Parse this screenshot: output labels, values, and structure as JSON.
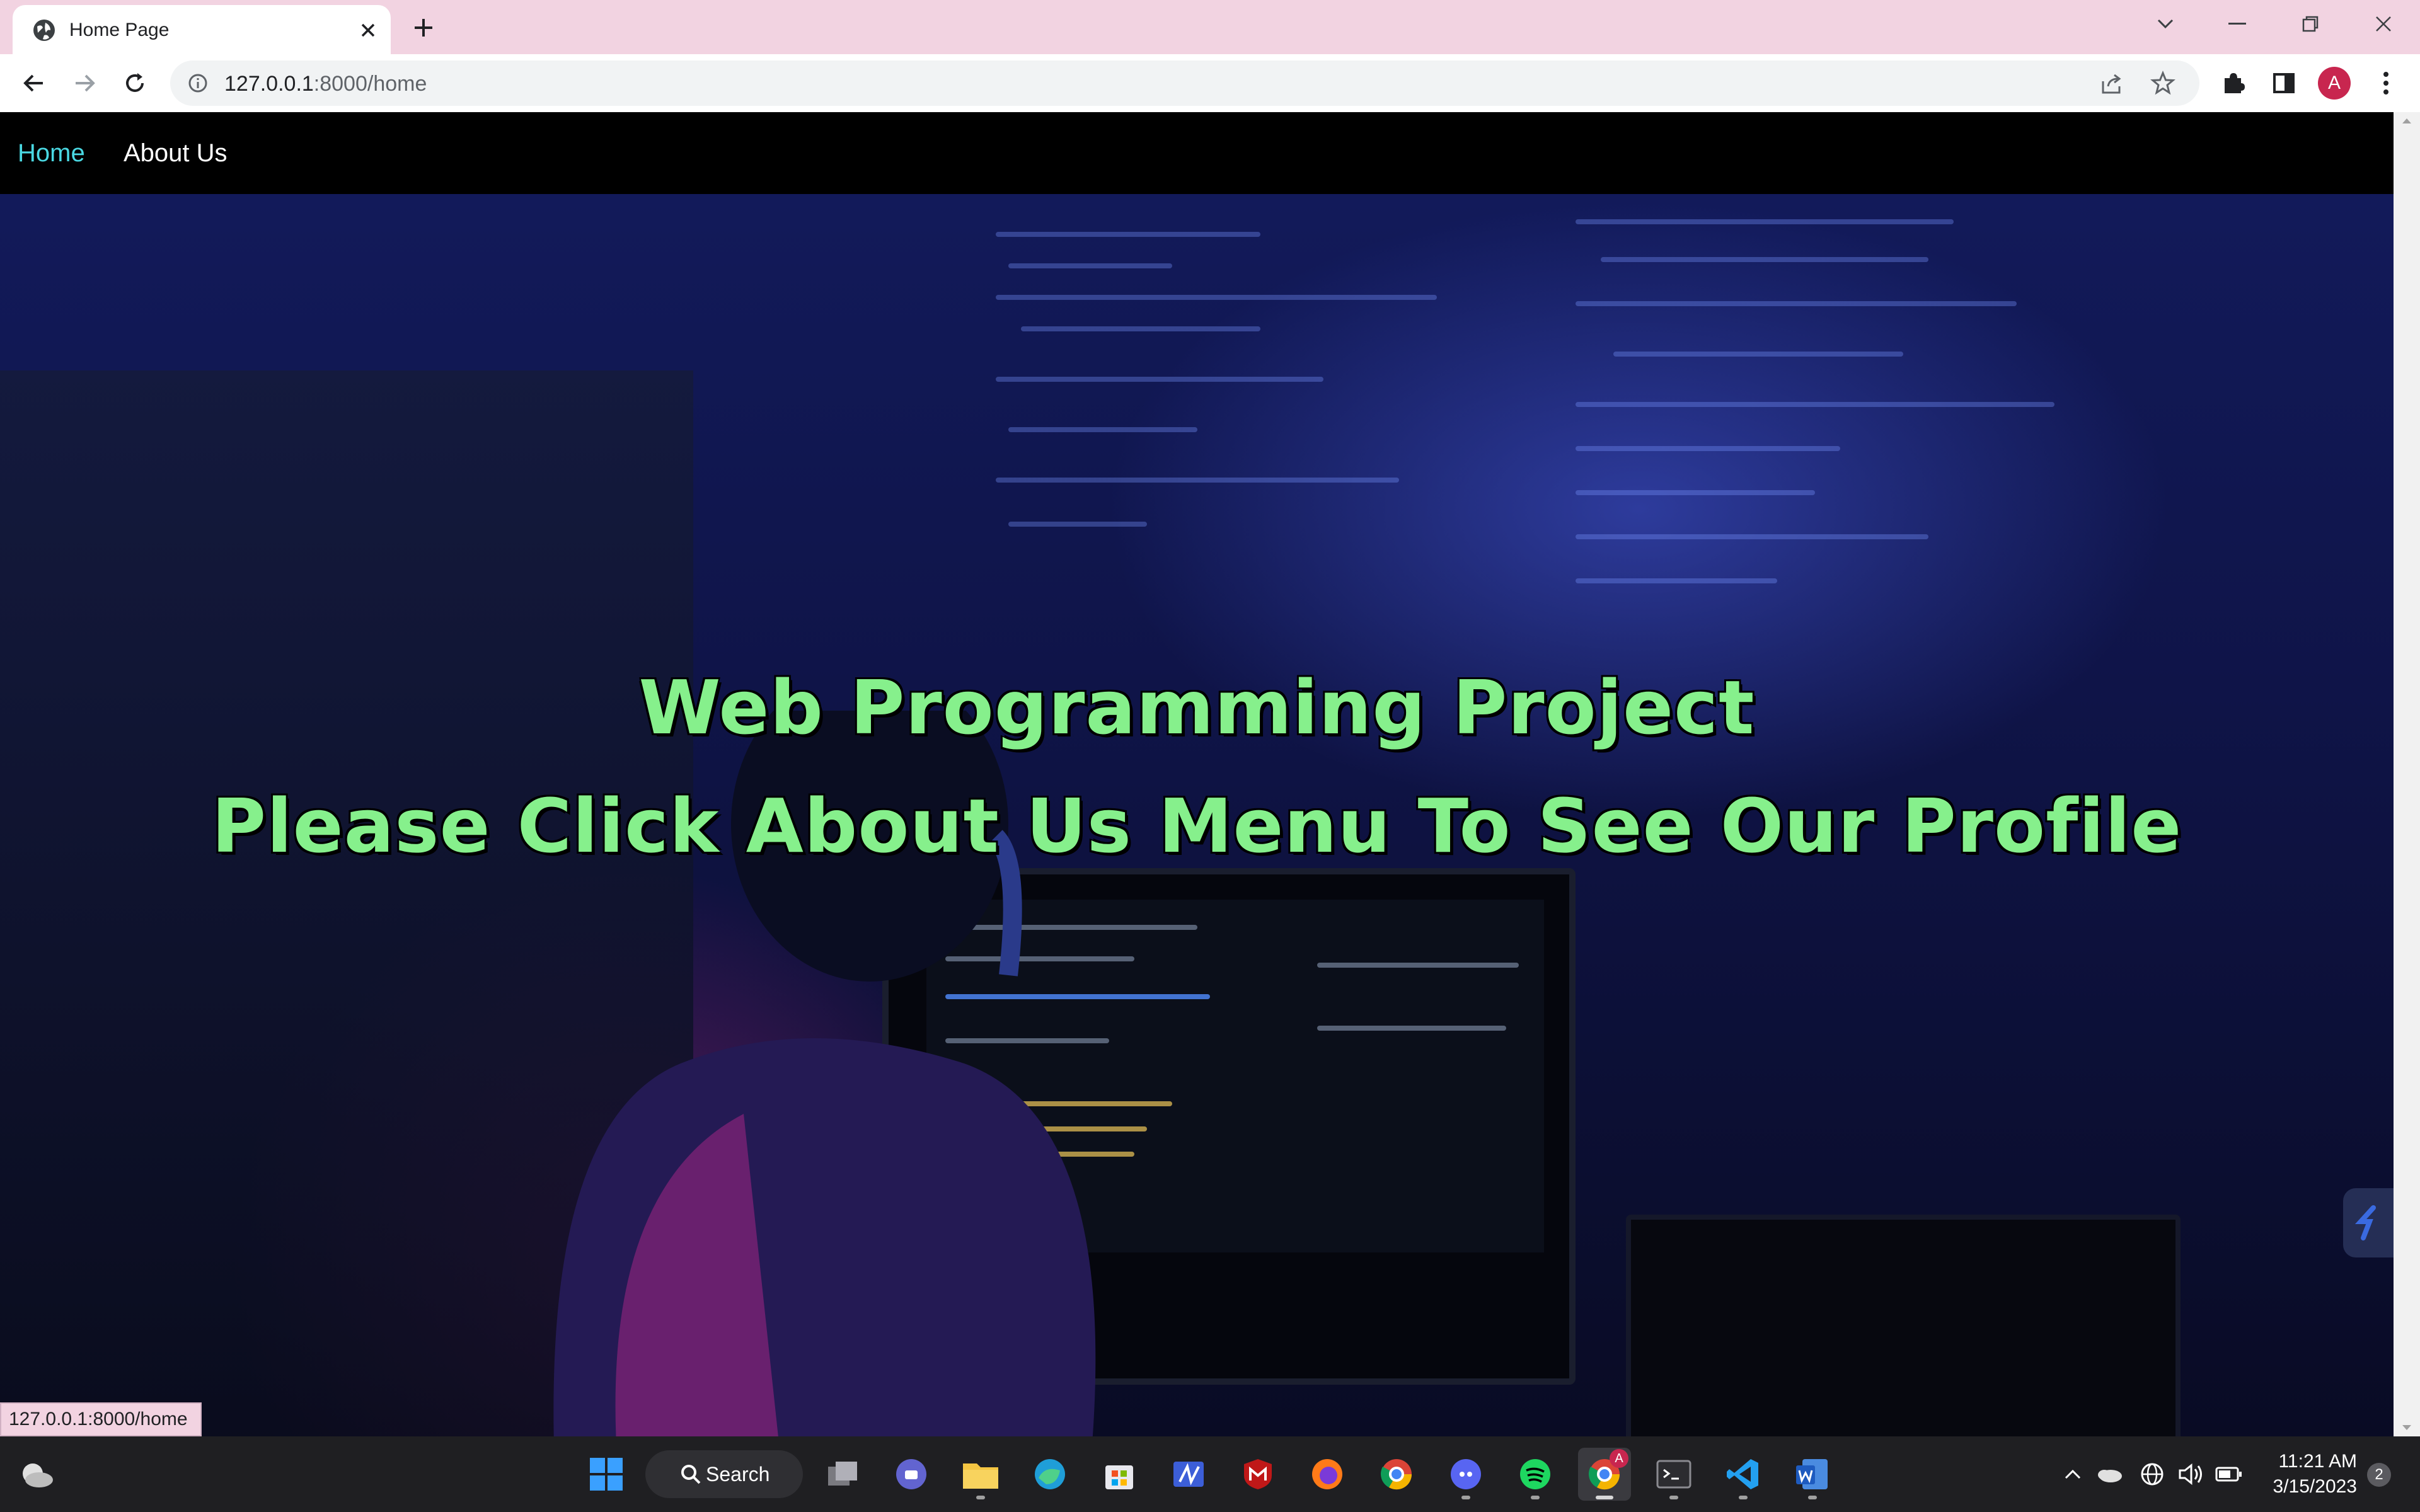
{
  "browser": {
    "tab_title": "Home Page",
    "url_host": "127.0.0.1",
    "url_path": ":8000/home",
    "avatar_letter": "A",
    "status_url": "127.0.0.1:8000/home"
  },
  "nav": {
    "items": [
      {
        "label": "Home",
        "active": true
      },
      {
        "label": "About Us",
        "active": false
      }
    ]
  },
  "hero": {
    "title": "Web Programming Project",
    "subtitle": "Please Click About Us Menu To See Our Profile"
  },
  "taskbar": {
    "search_label": "Search",
    "time": "11:21 AM",
    "date": "3/15/2023",
    "notification_count": "2",
    "chrome_badge": "A",
    "apps": [
      "start-icon",
      "search",
      "task-view-icon",
      "teams-icon",
      "file-explorer-icon",
      "edge-icon",
      "store-icon",
      "app-icon",
      "mcafee-icon",
      "firefox-icon",
      "chrome-icon",
      "discord-icon",
      "spotify-icon",
      "chrome-active-icon",
      "terminal-icon",
      "vscode-icon",
      "word-icon"
    ]
  },
  "colors": {
    "tabstrip": "#f2d3e1",
    "nav_active": "#4ad8e2",
    "hero_text": "#86f08c",
    "avatar": "#c8264f"
  }
}
